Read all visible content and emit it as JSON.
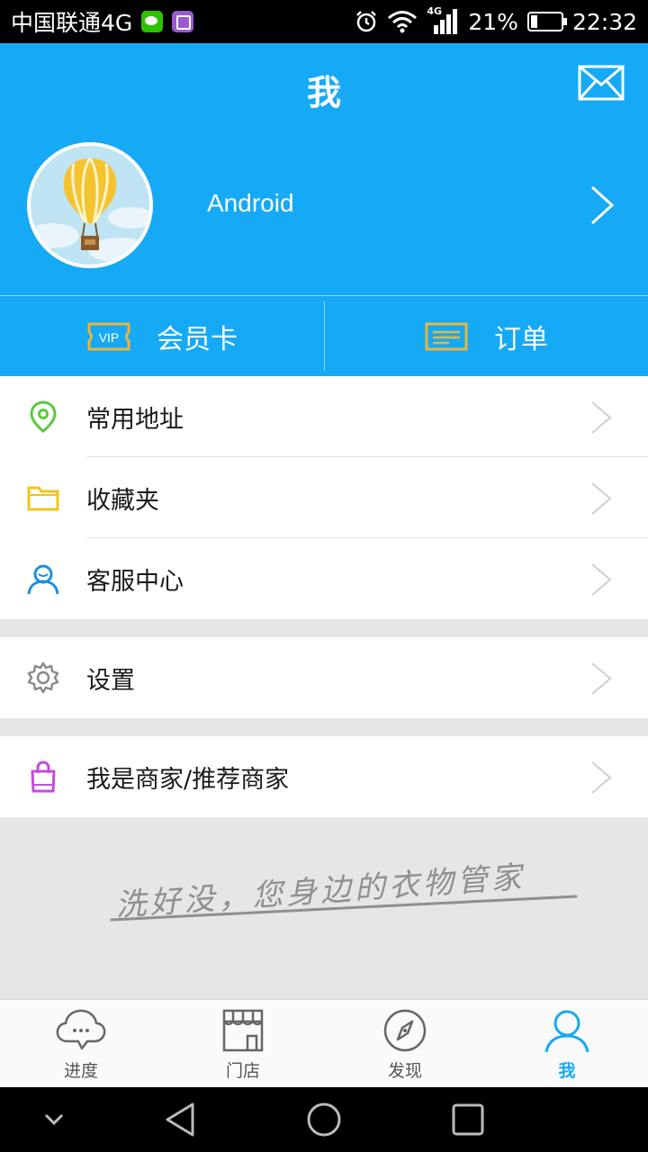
{
  "status_bar": {
    "carrier": "中国联通4G",
    "network_badge": "4G",
    "battery": "21%",
    "battery_level": 0.21,
    "time": "22:32",
    "icons": [
      "wechat-icon",
      "gallery-icon",
      "alarm-icon",
      "wifi-icon",
      "signal-icon",
      "battery-icon"
    ]
  },
  "header": {
    "title": "我",
    "mail_icon": "mail-icon",
    "username": "Android",
    "avatar": "hot-air-balloon-avatar"
  },
  "quick_actions": [
    {
      "label": "会员卡",
      "icon": "vip-card-icon",
      "badge": "VIP"
    },
    {
      "label": "订单",
      "icon": "order-icon"
    }
  ],
  "menu_groups": [
    [
      {
        "label": "常用地址",
        "icon": "location-pin-icon",
        "color": "#5cc93d"
      },
      {
        "label": "收藏夹",
        "icon": "folder-icon",
        "color": "#f0c419"
      },
      {
        "label": "客服中心",
        "icon": "customer-service-icon",
        "color": "#1d8fe0"
      }
    ],
    [
      {
        "label": "设置",
        "icon": "gear-icon",
        "color": "#8a8a8a"
      }
    ],
    [
      {
        "label": "我是商家/推荐商家",
        "icon": "shopping-bag-icon",
        "color": "#c64be0"
      }
    ]
  ],
  "slogan": "洗好没，您身边的衣物管家",
  "tabs": [
    {
      "label": "进度",
      "icon": "chat-cloud-icon",
      "active": false
    },
    {
      "label": "门店",
      "icon": "storefront-icon",
      "active": false
    },
    {
      "label": "发现",
      "icon": "compass-icon",
      "active": false
    },
    {
      "label": "我",
      "icon": "person-icon",
      "active": true
    }
  ],
  "colors": {
    "primary": "#16a9f5",
    "gold": "#e9b53f",
    "background": "#e6e6e6",
    "tab_inactive": "#555555"
  }
}
